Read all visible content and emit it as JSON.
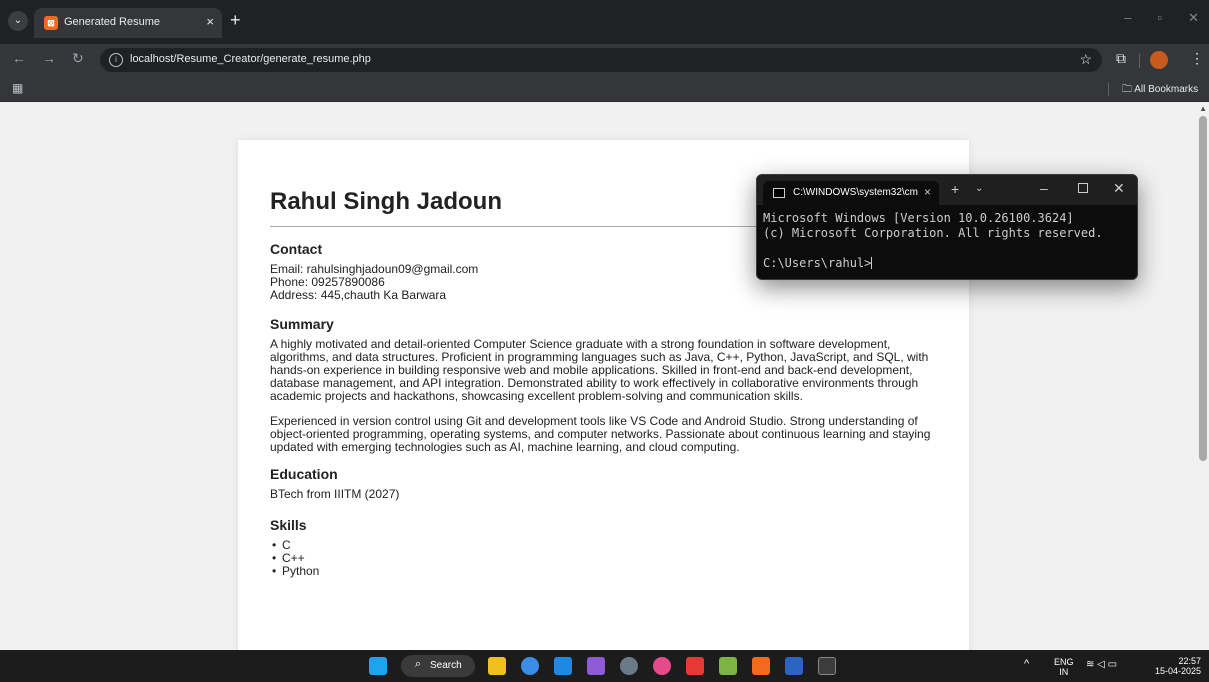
{
  "browser": {
    "tab_title": "Generated Resume",
    "url": "localhost/Resume_Creator/generate_resume.php",
    "all_bookmarks_label": "All Bookmarks"
  },
  "resume": {
    "name": "Rahul Singh Jadoun",
    "contact_heading": "Contact",
    "email": "Email: rahulsinghjadoun09@gmail.com",
    "phone": "Phone: 09257890086",
    "address": "Address: 445,chauth Ka Barwara",
    "summary_heading": "Summary",
    "summary_p1": "A highly motivated and detail-oriented Computer Science graduate with a strong foundation in software development, algorithms, and data structures. Proficient in programming languages such as Java, C++, Python, JavaScript, and SQL, with hands-on experience in building responsive web and mobile applications. Skilled in front-end and back-end development, database management, and API integration. Demonstrated ability to work effectively in collaborative environments through academic projects and hackathons, showcasing excellent problem-solving and communication skills.",
    "summary_p2": "Experienced in version control using Git and development tools like VS Code and Android Studio. Strong understanding of object-oriented programming, operating systems, and computer networks. Passionate about continuous learning and staying updated with emerging technologies such as AI, machine learning, and cloud computing.",
    "education_heading": "Education",
    "education": "BTech from IIITM (2027)",
    "skills_heading": "Skills",
    "skills": [
      "C",
      "C++",
      "Python"
    ]
  },
  "terminal": {
    "tab_title": "C:\\WINDOWS\\system32\\cm",
    "line1": "Microsoft Windows [Version 10.0.26100.3624]",
    "line2": "(c) Microsoft Corporation. All rights reserved.",
    "prompt": "C:\\Users\\rahul>"
  },
  "taskbar": {
    "search_label": "Search",
    "lang_line1": "ENG",
    "lang_line2": "IN",
    "time": "22:57",
    "date": "15-04-2025"
  }
}
